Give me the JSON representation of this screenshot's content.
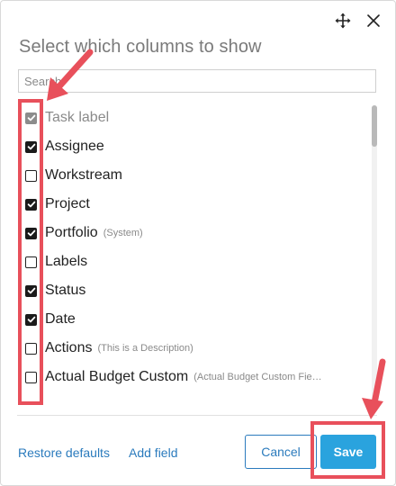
{
  "dialog": {
    "title": "Select which columns to show",
    "search": {
      "placeholder": "Search",
      "value": ""
    }
  },
  "columns": [
    {
      "label": "Task label",
      "description": "",
      "checked": true,
      "disabled": true
    },
    {
      "label": "Assignee",
      "description": "",
      "checked": true,
      "disabled": false
    },
    {
      "label": "Workstream",
      "description": "",
      "checked": false,
      "disabled": false
    },
    {
      "label": "Project",
      "description": "",
      "checked": true,
      "disabled": false
    },
    {
      "label": "Portfolio",
      "description": "(System)",
      "checked": true,
      "disabled": false
    },
    {
      "label": "Labels",
      "description": "",
      "checked": false,
      "disabled": false
    },
    {
      "label": "Status",
      "description": "",
      "checked": true,
      "disabled": false
    },
    {
      "label": "Date",
      "description": "",
      "checked": true,
      "disabled": false
    },
    {
      "label": "Actions",
      "description": "(This is a Description)",
      "checked": false,
      "disabled": false
    },
    {
      "label": "Actual Budget Custom",
      "description": "(Actual Budget Custom Fie…",
      "checked": false,
      "disabled": false
    }
  ],
  "footer": {
    "restore_defaults": "Restore defaults",
    "add_field": "Add field",
    "cancel": "Cancel",
    "save": "Save"
  },
  "icons": {
    "move": "move-icon",
    "close": "close-icon"
  },
  "colors": {
    "accent": "#2aa3de",
    "link": "#2b7bbd",
    "annotation": "#e8505b"
  }
}
